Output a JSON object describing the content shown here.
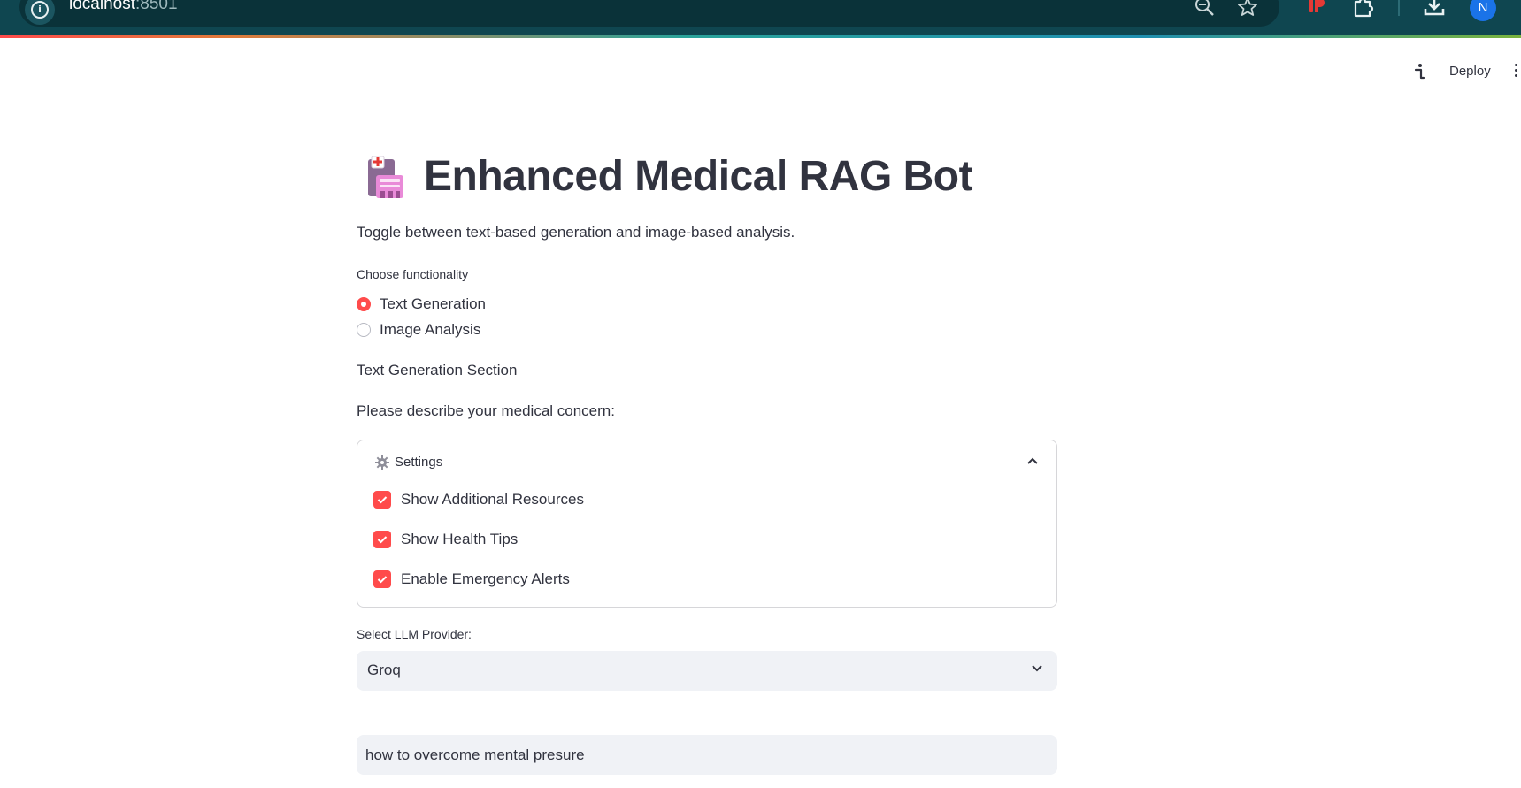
{
  "browser": {
    "url_host": "localhost",
    "url_port": ":8501",
    "profile_initial": "N"
  },
  "app_header": {
    "deploy_label": "Deploy"
  },
  "page": {
    "title": "Enhanced Medical RAG Bot",
    "title_icon": "medical-kit-icon",
    "caption": "Toggle between text-based generation and image-based analysis."
  },
  "functionality": {
    "label": "Choose functionality",
    "options": [
      {
        "label": "Text Generation",
        "selected": true
      },
      {
        "label": "Image Analysis",
        "selected": false
      }
    ]
  },
  "section_title": "Text Generation Section",
  "prompt_label": "Please describe your medical concern:",
  "settings": {
    "title": "Settings",
    "expanded": true,
    "checkboxes": [
      {
        "label": "Show Additional Resources",
        "checked": true
      },
      {
        "label": "Show Health Tips",
        "checked": true
      },
      {
        "label": "Enable Emergency Alerts",
        "checked": true
      }
    ]
  },
  "llm_provider": {
    "label": "Select LLM Provider:",
    "value": "Groq"
  },
  "query_input": {
    "value": "how to overcome mental presure"
  },
  "colors": {
    "accent": "#ff4b4b",
    "text": "#31333f",
    "input_bg": "#f0f2f6",
    "chrome_bg": "#0f4650"
  }
}
